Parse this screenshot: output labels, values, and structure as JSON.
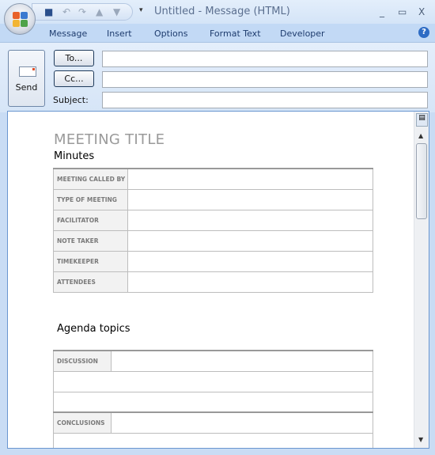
{
  "window": {
    "title": "Untitled - Message (HTML)",
    "controls": [
      "_",
      "▭",
      "X"
    ]
  },
  "quick_access": {
    "icons": [
      "save-icon",
      "undo-icon",
      "redo-icon",
      "previous-icon",
      "next-icon",
      "customize-icon"
    ]
  },
  "tabs": [
    "Message",
    "Insert",
    "Options",
    "Format Text",
    "Developer"
  ],
  "help": "?",
  "header": {
    "send_label": "Send",
    "to_label": "To...",
    "cc_label": "Cc...",
    "subject_label": "Subject:",
    "to_value": "",
    "cc_value": "",
    "subject_value": ""
  },
  "document": {
    "title": "MEETING TITLE",
    "subtitle": "Minutes",
    "info_rows": [
      "MEETING CALLED BY",
      "TYPE OF MEETING",
      "FACILITATOR",
      "NOTE TAKER",
      "TIMEKEEPER",
      "ATTENDEES"
    ],
    "agenda_heading": "Agenda topics",
    "discussion_label": "DISCUSSION",
    "conclusions_label": "CONCLUSIONS"
  },
  "colors": {
    "accent": "#2e6cc4",
    "title_gray": "#9a9a9a",
    "label_bg": "#f2f2f2"
  }
}
